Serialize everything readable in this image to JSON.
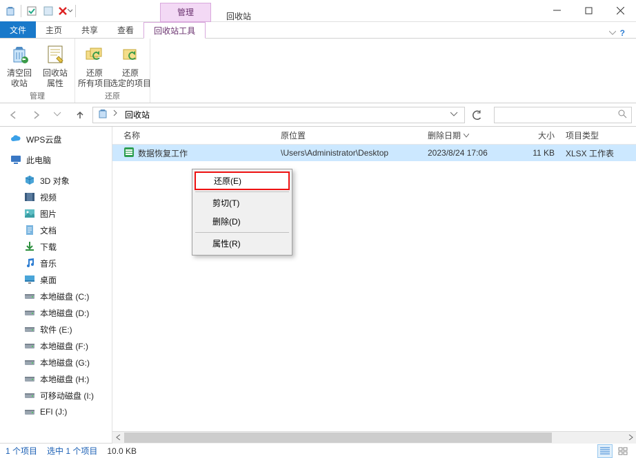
{
  "title_bar": {
    "context_tab": "管理",
    "window_title": "回收站"
  },
  "ribbon": {
    "file_tab": "文件",
    "tabs": [
      "主页",
      "共享",
      "查看",
      "回收站工具"
    ],
    "active_tab_index": 3,
    "group_manage": {
      "label": "管理",
      "empty": "清空回\n收站",
      "props": "回收站\n属性"
    },
    "group_restore": {
      "label": "还原",
      "restore_all": "还原\n所有项目",
      "restore_sel": "还原\n选定的项目"
    }
  },
  "nav": {
    "location": "回收站"
  },
  "tree": {
    "items": [
      {
        "icon": "cloud",
        "label": "WPS云盘",
        "lvl": 1
      },
      {
        "icon": "monitor",
        "label": "此电脑",
        "lvl": 1
      },
      {
        "icon": "cube",
        "label": "3D 对象",
        "lvl": 2
      },
      {
        "icon": "film",
        "label": "视频",
        "lvl": 2
      },
      {
        "icon": "picture",
        "label": "图片",
        "lvl": 2
      },
      {
        "icon": "doc",
        "label": "文档",
        "lvl": 2
      },
      {
        "icon": "download",
        "label": "下载",
        "lvl": 2
      },
      {
        "icon": "music",
        "label": "音乐",
        "lvl": 2
      },
      {
        "icon": "desktop",
        "label": "桌面",
        "lvl": 2
      },
      {
        "icon": "drive",
        "label": "本地磁盘 (C:)",
        "lvl": 2
      },
      {
        "icon": "drive",
        "label": "本地磁盘 (D:)",
        "lvl": 2
      },
      {
        "icon": "drive",
        "label": "软件 (E:)",
        "lvl": 2
      },
      {
        "icon": "drive",
        "label": "本地磁盘 (F:)",
        "lvl": 2
      },
      {
        "icon": "drive",
        "label": "本地磁盘 (G:)",
        "lvl": 2
      },
      {
        "icon": "drive",
        "label": "本地磁盘 (H:)",
        "lvl": 2
      },
      {
        "icon": "drive",
        "label": "可移动磁盘 (I:)",
        "lvl": 2
      },
      {
        "icon": "drive",
        "label": "EFI (J:)",
        "lvl": 2
      }
    ]
  },
  "columns": {
    "name": "名称",
    "orig": "原位置",
    "del": "删除日期",
    "size": "大小",
    "type": "项目类型"
  },
  "rows": [
    {
      "name": "数据恢复工作",
      "orig": "\\Users\\Administrator\\Desktop",
      "del": "2023/8/24 17:06",
      "size": "11 KB",
      "type": "XLSX 工作表"
    }
  ],
  "context_menu": {
    "restore": "还原(E)",
    "cut": "剪切(T)",
    "delete": "删除(D)",
    "props": "属性(R)"
  },
  "status": {
    "count": "1 个项目",
    "selected": "选中 1 个项目",
    "size": "10.0 KB"
  }
}
